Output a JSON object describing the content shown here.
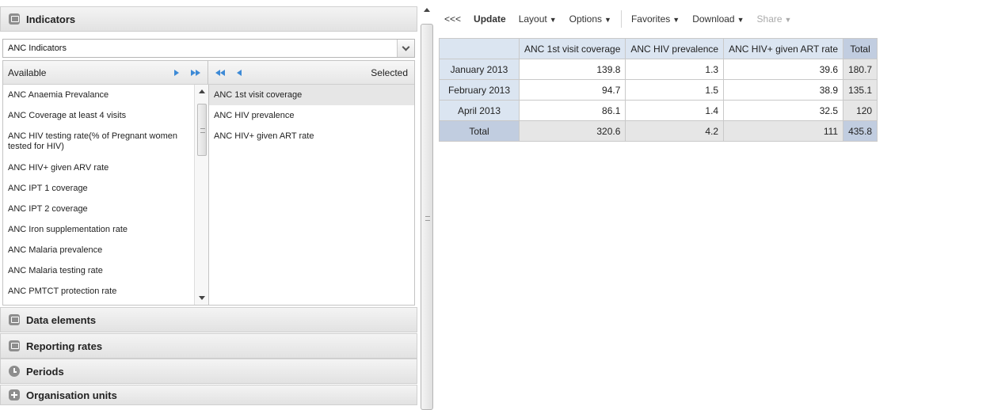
{
  "left_panel": {
    "indicators_header": "Indicators",
    "group_select_value": "ANC Indicators",
    "available_label": "Available",
    "selected_label": "Selected",
    "available_items": [
      "ANC Anaemia Prevalance",
      "ANC Coverage at least 4 visits",
      "ANC HIV testing rate(% of Pregnant women tested for HIV)",
      "ANC HIV+ given ARV rate",
      "ANC IPT 1 coverage",
      "ANC IPT 2 coverage",
      "ANC Iron supplementation rate",
      "ANC Malaria prevalence",
      "ANC Malaria testing rate",
      "ANC PMTCT protection rate"
    ],
    "selected_items": [
      "ANC 1st visit coverage",
      "ANC HIV prevalence",
      "ANC HIV+ given ART rate"
    ],
    "sections": [
      {
        "label": "Data elements",
        "icon": "data-elements-icon"
      },
      {
        "label": "Reporting rates",
        "icon": "reporting-rates-icon"
      },
      {
        "label": "Periods",
        "icon": "periods-clock-icon"
      },
      {
        "label": "Organisation units",
        "icon": "organisation-units-plus-icon"
      }
    ]
  },
  "toolbar": {
    "collapse_label": "<<<",
    "update_label": "Update",
    "layout_label": "Layout",
    "options_label": "Options",
    "favorites_label": "Favorites",
    "download_label": "Download",
    "share_label": "Share"
  },
  "table": {
    "columns": [
      "ANC 1st visit coverage",
      "ANC HIV prevalence",
      "ANC HIV+ given ART rate",
      "Total"
    ],
    "rows": [
      {
        "label": "January 2013",
        "values": [
          "139.8",
          "1.3",
          "39.6",
          "180.7"
        ]
      },
      {
        "label": "February 2013",
        "values": [
          "94.7",
          "1.5",
          "38.9",
          "135.1"
        ]
      },
      {
        "label": "April 2013",
        "values": [
          "86.1",
          "1.4",
          "32.5",
          "120"
        ]
      }
    ],
    "total_row": {
      "label": "Total",
      "values": [
        "320.6",
        "4.2",
        "111",
        "435.8"
      ]
    }
  },
  "colors": {
    "header_blue": "#dbe5f1",
    "total_blue": "#c1cde0",
    "arrow_blue": "#3d8ad6"
  }
}
